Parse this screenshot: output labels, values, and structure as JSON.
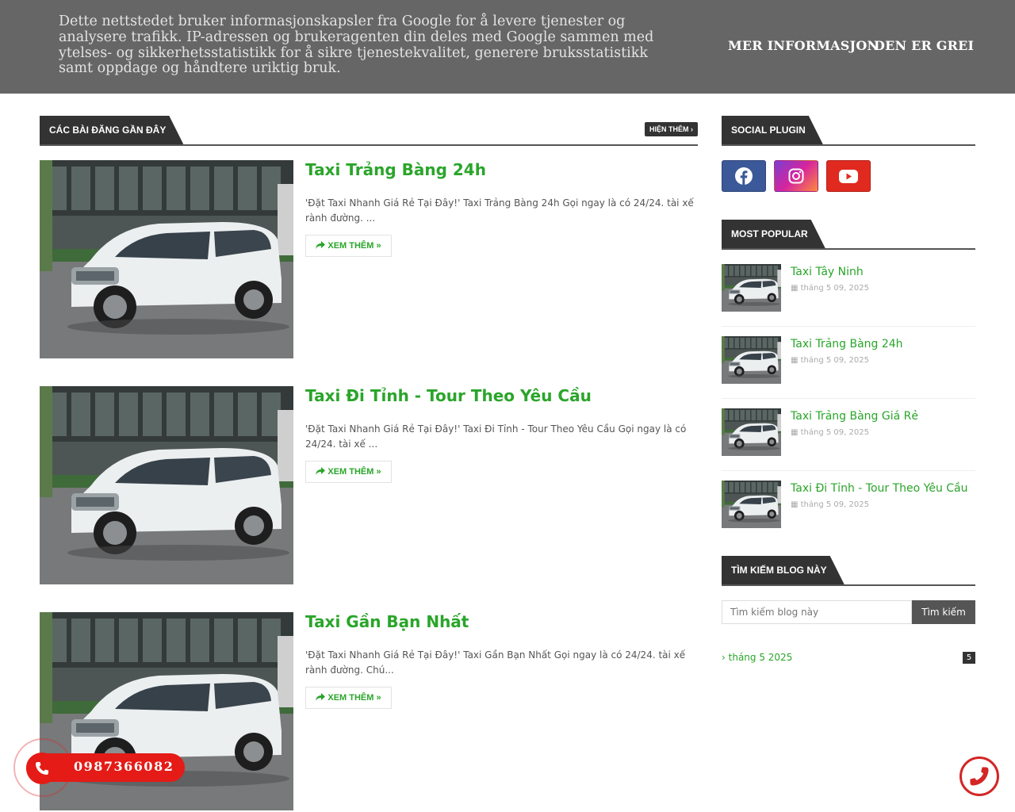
{
  "cookie": {
    "text": "Dette nettstedet bruker informasjonskapsler fra Google for å levere tjenester og analysere trafikk. IP-adressen og brukeragenten din deles med Google sammen med ytelses- og sikkerhetsstatistikk for å sikre tjenestekvalitet, generere bruksstatistikk samt oppdage og håndtere uriktig bruk.",
    "more_info": "MER INFORMASJON",
    "ok": "DEN ER GREI"
  },
  "recent": {
    "heading": "CÁC BÀI ĐĂNG GẦN ĐÂY",
    "show_more": "HIỆN THÊM",
    "readmore": "XEM THÊM »",
    "posts": [
      {
        "title": "Taxi Trảng Bàng 24h",
        "snippet": "'Đặt Taxi Nhanh Giá Rẻ Tại Đây!' Taxi Trảng Bàng 24h  Gọi ngay là có 24/24. tài xế rành đường. ..."
      },
      {
        "title": "Taxi Đi Tỉnh - Tour Theo Yêu Cầu",
        "snippet": "'Đặt Taxi Nhanh Giá Rẻ Tại Đây!' Taxi Đi Tỉnh - Tour Theo Yêu Cầu  Gọi ngay là có 24/24. tài xế ..."
      },
      {
        "title": "Taxi Gần Bạn Nhất",
        "snippet": "'Đặt Taxi Nhanh Giá Rẻ Tại Đây!' Taxi Gần Bạn Nhất   Gọi ngay là có 24/24. tài xế rành đường. Chú..."
      }
    ]
  },
  "sidebar": {
    "social_heading": "SOCIAL PLUGIN",
    "social": [
      {
        "name": "facebook",
        "color": "#3b5998"
      },
      {
        "name": "instagram",
        "color": "#c13584"
      },
      {
        "name": "youtube",
        "color": "#e02a20"
      }
    ],
    "popular_heading": "MOST POPULAR",
    "popular": [
      {
        "title": "Taxi Tây Ninh",
        "date": "tháng 5 09, 2025"
      },
      {
        "title": "Taxi Trảng Bàng 24h",
        "date": "tháng 5 09, 2025"
      },
      {
        "title": "Taxi Trảng Bàng Giá Rẻ",
        "date": "tháng 5 09, 2025"
      },
      {
        "title": "Taxi Đi Tỉnh - Tour Theo Yêu Cầu",
        "date": "tháng 5 09, 2025"
      }
    ],
    "search_heading": "TÌM KIẾM BLOG NÀY",
    "search_placeholder": "Tìm kiếm blog này",
    "search_button": "Tìm kiếm",
    "archive_label": "tháng 5 2025",
    "archive_count": "5"
  },
  "phone": {
    "number": "0987366082"
  },
  "colors": {
    "accent": "#2aa52a",
    "dark": "#333333",
    "phone_red": "#e41b17"
  }
}
